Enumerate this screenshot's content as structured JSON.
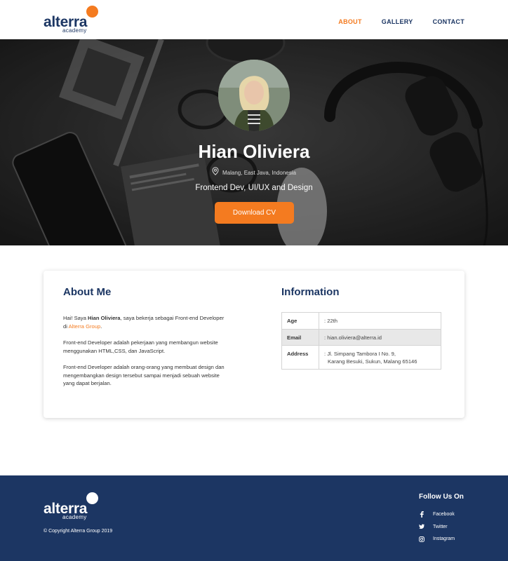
{
  "brand": {
    "name": "alterra",
    "sub": "academy"
  },
  "nav": {
    "items": [
      "ABOUT",
      "GALLERY",
      "CONTACT"
    ],
    "active": "ABOUT"
  },
  "hero": {
    "name": "Hian Oliviera",
    "location": "Malang, East Java, Indonesia",
    "role": "Frontend Dev, UI/UX and Design",
    "cta": "Download CV"
  },
  "about": {
    "title": "About Me",
    "p1_a": "Hai! Saya ",
    "p1_b": "Hian Oliviera",
    "p1_c": ", saya bekerja sebagai Front-end Developer di ",
    "p1_d": "Alterra Group",
    "p1_e": ".",
    "p2": "Front-end Developer adalah pekerjaan yang membangun website menggunakan HTML,CSS, dan JavaScript.",
    "p3": "Front-end Developer adalah orang-orang yang membuat design dan mengembangkan design tersebut sampai menjadi sebuah website yang dapat berjalan."
  },
  "information": {
    "title": "Information",
    "rows": [
      {
        "key": "Age",
        "value": ": 22th"
      },
      {
        "key": "Email",
        "value": ": hian.oliviera@alterra.id"
      },
      {
        "key": "Address",
        "value_line1": ": Jl. Simpang Tambora I No. 9,",
        "value_line2": "Karang Besuki, Sukun, Malang 65146"
      }
    ]
  },
  "footer": {
    "copyright": "© Copyright Alterra Group 2019",
    "follow_title": "Follow Us On",
    "social": [
      "Facebook",
      "Twitter",
      "Instagram"
    ]
  },
  "colors": {
    "accent": "#f47b20",
    "navy": "#1c3663"
  },
  "icons": {
    "location": "location-pin-icon",
    "facebook": "facebook-icon",
    "twitter": "twitter-icon",
    "instagram": "instagram-icon"
  }
}
